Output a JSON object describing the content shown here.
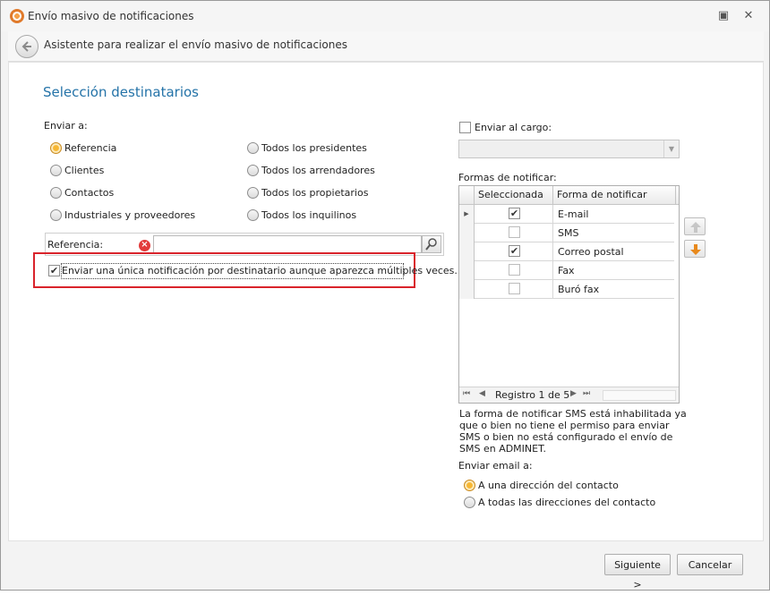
{
  "window": {
    "title": "Envío masivo de notificaciones",
    "restore_glyph": "▣",
    "close_glyph": "✕"
  },
  "header": {
    "text": "Asistente para realizar el envío masivo de notificaciones"
  },
  "section_title": "Selección destinatarios",
  "enviar_a": {
    "label": "Enviar a:",
    "options": [
      {
        "label": "Referencia",
        "selected": true
      },
      {
        "label": "Clientes",
        "selected": false
      },
      {
        "label": "Contactos",
        "selected": false
      },
      {
        "label": "Industriales y proveedores",
        "selected": false
      },
      {
        "label": "Todos los presidentes",
        "selected": false
      },
      {
        "label": "Todos los arrendadores",
        "selected": false
      },
      {
        "label": "Todos los propietarios",
        "selected": false
      },
      {
        "label": "Todos los inquilinos",
        "selected": false
      }
    ]
  },
  "referencia": {
    "label": "Referencia:",
    "value": ""
  },
  "unique_notification": {
    "label": "Enviar una única notificación por destinatario aunque aparezca múltiples veces.",
    "checked": true
  },
  "cargo": {
    "label": "Enviar al cargo:",
    "checked": false,
    "value": ""
  },
  "formas": {
    "label": "Formas de notificar:",
    "columns": [
      "Seleccionada",
      "Forma de notificar"
    ],
    "rows": [
      {
        "name": "E-mail",
        "checked": true
      },
      {
        "name": "SMS",
        "checked": false
      },
      {
        "name": "Correo postal",
        "checked": true
      },
      {
        "name": "Fax",
        "checked": false
      },
      {
        "name": "Buró fax",
        "checked": false
      }
    ],
    "navigator": "Registro 1 de 5"
  },
  "sms_note": "La forma de notificar SMS está inhabilitada ya que o bien no tiene el permiso para enviar SMS o bien no está configurado el envío de SMS en ADMINET.",
  "email": {
    "label": "Enviar email a:",
    "options": [
      {
        "label": "A una dirección del contacto",
        "selected": true
      },
      {
        "label": "A todas las direcciones del contacto",
        "selected": false
      }
    ]
  },
  "buttons": {
    "next": "Siguiente >",
    "cancel": "Cancelar"
  },
  "colors": {
    "accent": "#2473a8",
    "highlight_border": "#d9232b",
    "radio_selected": "#f7b733",
    "move_down_arrow": "#e8891c"
  }
}
